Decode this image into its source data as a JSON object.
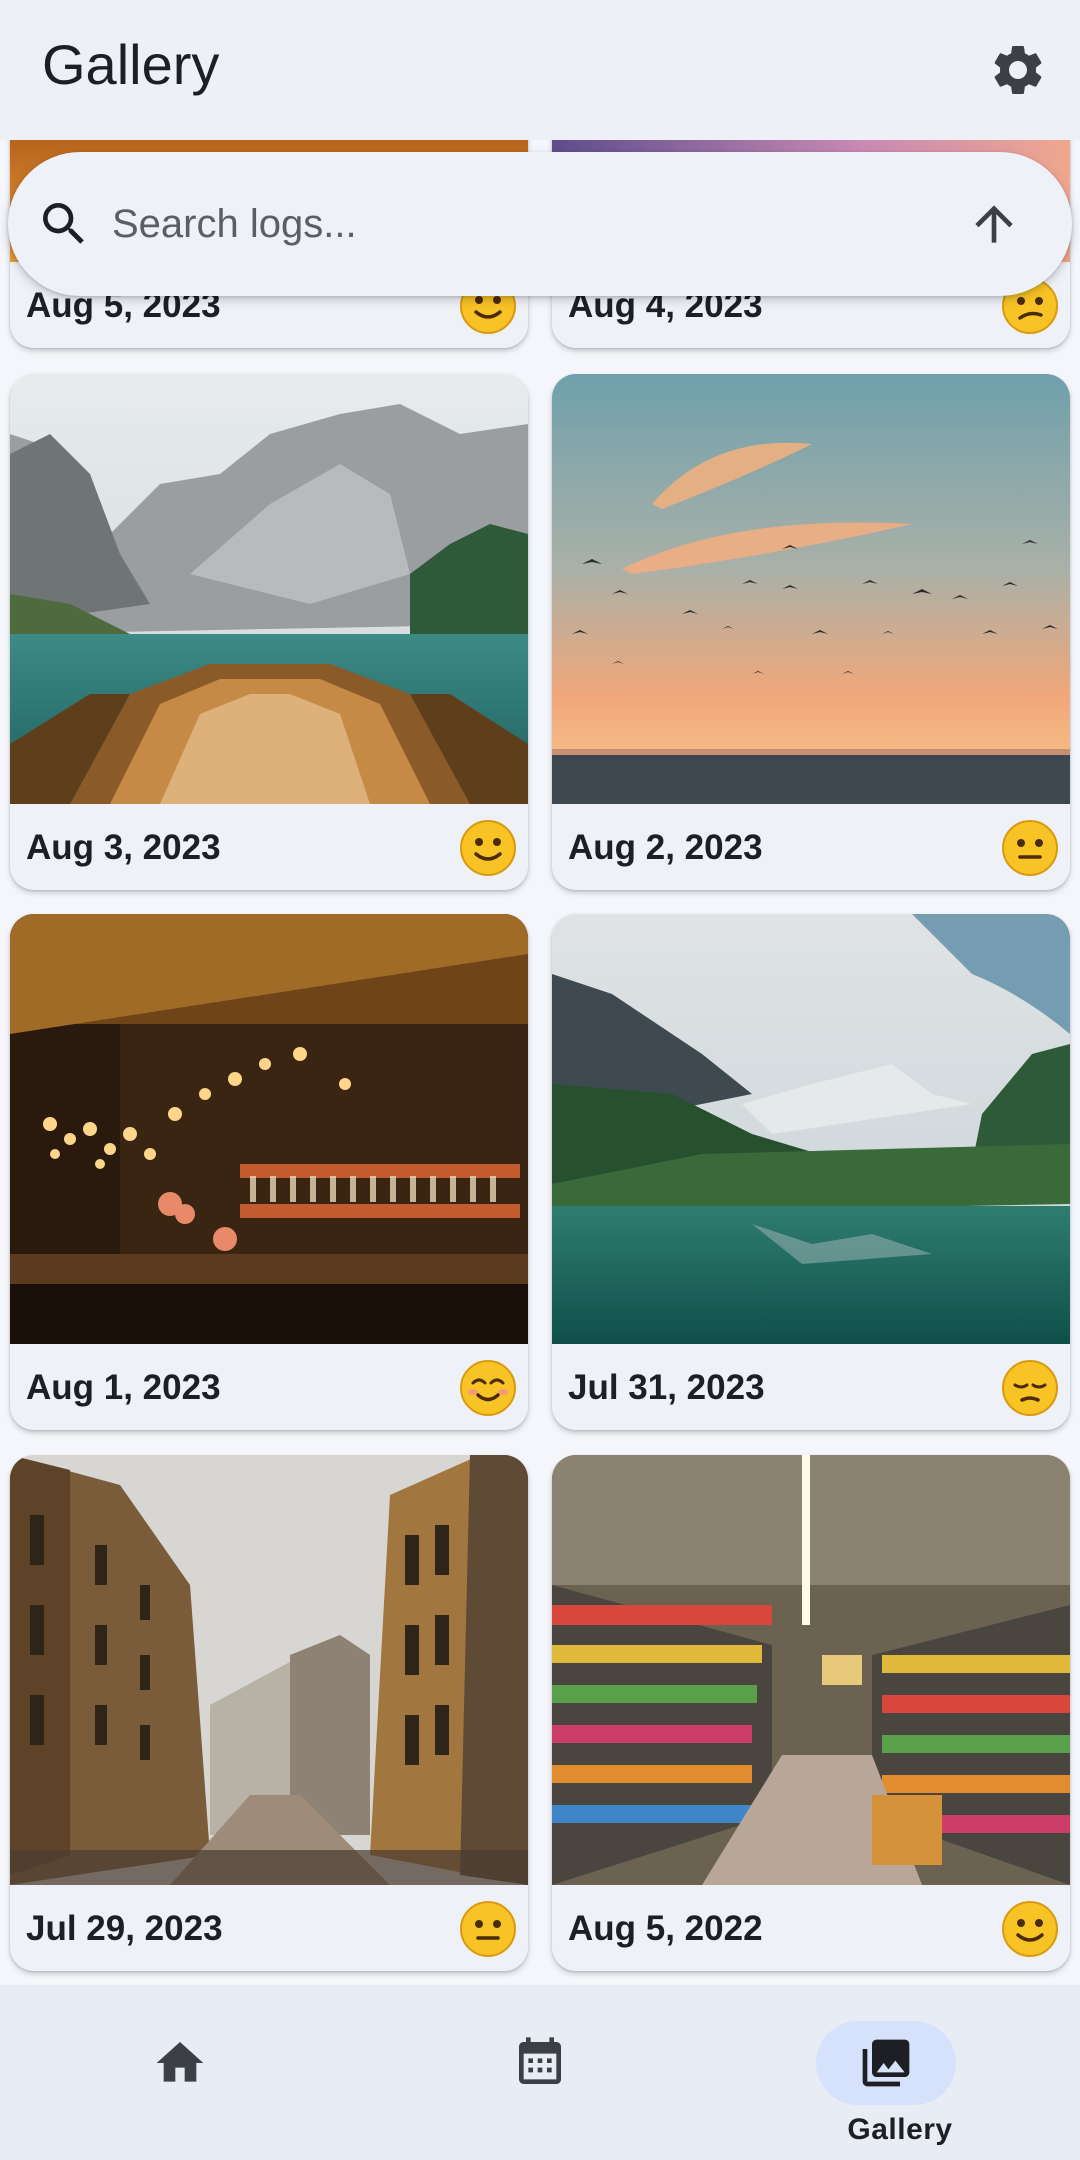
{
  "app": {
    "title": "Gallery"
  },
  "search": {
    "placeholder": "Search logs..."
  },
  "cards": [
    {
      "date": "Aug 5, 2023",
      "mood": "slightly-smiling-face"
    },
    {
      "date": "Aug 4, 2023",
      "mood": "confused-face"
    },
    {
      "date": "Aug 3, 2023",
      "mood": "slightly-smiling-face"
    },
    {
      "date": "Aug 2, 2023",
      "mood": "neutral-face"
    },
    {
      "date": "Aug 1, 2023",
      "mood": "smiling-face"
    },
    {
      "date": "Jul 31, 2023",
      "mood": "pensive-face"
    },
    {
      "date": "Jul 29, 2023",
      "mood": "neutral-face"
    },
    {
      "date": "Aug 5, 2022",
      "mood": "slightly-smiling-face"
    }
  ],
  "bottom_nav": {
    "items": [
      {
        "icon": "home-icon",
        "label": ""
      },
      {
        "icon": "calendar-icon",
        "label": ""
      },
      {
        "icon": "photo-library-icon",
        "label": "Gallery"
      }
    ],
    "active_index": 2
  },
  "colors": {
    "background": "#f4f6fb",
    "app_bar": "#edf0f7",
    "card_caption": "#eef1f8",
    "nav_active_pill": "#d6e2fb",
    "emoji_yellow": "#f7c325"
  }
}
